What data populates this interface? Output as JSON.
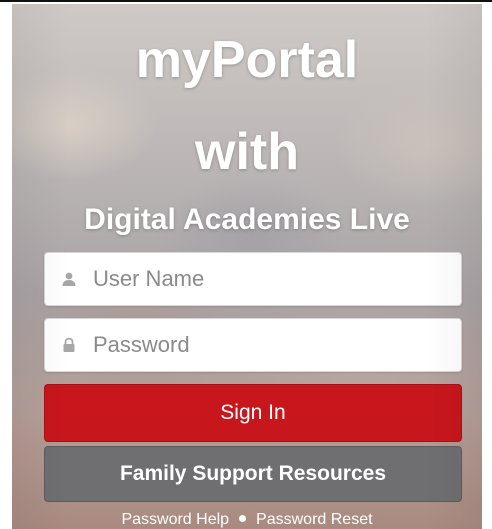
{
  "heading": {
    "line1": "myPortal",
    "line2": "with",
    "line3": "Digital Academies Live"
  },
  "form": {
    "username_placeholder": "User Name",
    "username_value": "",
    "username_icon": "user-icon",
    "password_placeholder": "Password",
    "password_value": "",
    "password_icon": "lock-icon"
  },
  "buttons": {
    "sign_in": "Sign In",
    "family_support": "Family Support Resources"
  },
  "footer_links": {
    "password_help": "Password Help",
    "password_reset": "Password Reset"
  },
  "colors": {
    "sign_in_bg": "#c8161d",
    "family_support_bg": "#6f6f71"
  }
}
